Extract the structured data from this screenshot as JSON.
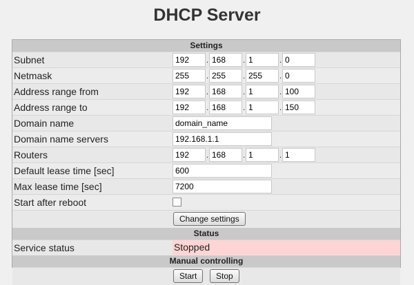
{
  "page": {
    "title": "DHCP Server"
  },
  "settings": {
    "header": "Settings",
    "subnet": {
      "label": "Subnet",
      "octets": [
        "192",
        "168",
        "1",
        "0"
      ]
    },
    "netmask": {
      "label": "Netmask",
      "octets": [
        "255",
        "255",
        "255",
        "0"
      ]
    },
    "range_from": {
      "label": "Address range from",
      "octets": [
        "192",
        "168",
        "1",
        "100"
      ]
    },
    "range_to": {
      "label": "Address range to",
      "octets": [
        "192",
        "168",
        "1",
        "150"
      ]
    },
    "domain_name": {
      "label": "Domain name",
      "value": "domain_name"
    },
    "dns_servers": {
      "label": "Domain name servers",
      "value": "192.168.1.1"
    },
    "routers": {
      "label": "Routers",
      "octets": [
        "192",
        "168",
        "1",
        "1"
      ]
    },
    "default_lease": {
      "label": "Default lease time [sec]",
      "value": "600"
    },
    "max_lease": {
      "label": "Max lease time [sec]",
      "value": "7200"
    },
    "start_after_reboot": {
      "label": "Start after reboot",
      "checked": false
    },
    "change_button": "Change settings"
  },
  "status": {
    "header": "Status",
    "service_label": "Service status",
    "service_value": "Stopped",
    "service_color": "#ffd4d4"
  },
  "manual": {
    "header": "Manual controlling",
    "start_button": "Start",
    "stop_button": "Stop"
  }
}
